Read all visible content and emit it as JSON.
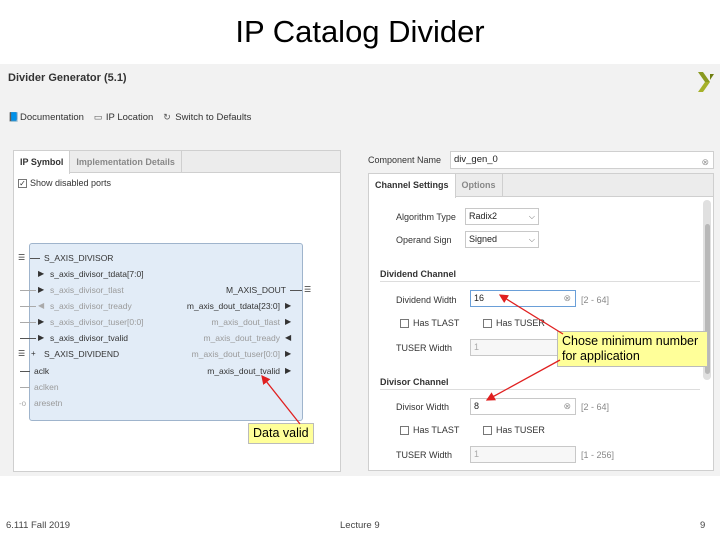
{
  "slide": {
    "title": "IP Catalog Divider",
    "footer_left": "6.111 Fall 2019",
    "footer_center": "Lecture 9",
    "footer_right": "9"
  },
  "app": {
    "header": "Divider Generator (5.1)",
    "toolbar": {
      "documentation": "Documentation",
      "ip_location": "IP Location",
      "switch_defaults": "Switch to Defaults"
    },
    "left_tabs": [
      "IP Symbol",
      "Implementation Details"
    ],
    "show_disabled_ports": "Show disabled ports",
    "symbol": {
      "left_ports": [
        {
          "name": "S_AXIS_DIVISOR",
          "dim": false
        },
        {
          "name": "s_axis_divisor_tdata[7:0]",
          "dim": false
        },
        {
          "name": "s_axis_divisor_tlast",
          "dim": true
        },
        {
          "name": "s_axis_divisor_tready",
          "dim": true
        },
        {
          "name": "s_axis_divisor_tuser[0:0]",
          "dim": true
        },
        {
          "name": "s_axis_divisor_tvalid",
          "dim": false
        },
        {
          "name": "S_AXIS_DIVIDEND",
          "dim": false
        },
        {
          "name": "aclk",
          "dim": false
        },
        {
          "name": "aclken",
          "dim": true
        },
        {
          "name": "aresetn",
          "dim": true
        }
      ],
      "right_ports": [
        {
          "name": "M_AXIS_DOUT",
          "dim": false
        },
        {
          "name": "m_axis_dout_tdata[23:0]",
          "dim": false
        },
        {
          "name": "m_axis_dout_tlast",
          "dim": true
        },
        {
          "name": "m_axis_dout_tready",
          "dim": true
        },
        {
          "name": "m_axis_dout_tuser[0:0]",
          "dim": true
        },
        {
          "name": "m_axis_dout_tvalid",
          "dim": false
        }
      ]
    },
    "component_name_label": "Component Name",
    "component_name_value": "div_gen_0",
    "right_tabs": [
      "Channel Settings",
      "Options"
    ],
    "algorithm_type_label": "Algorithm Type",
    "algorithm_type_value": "Radix2",
    "operand_sign_label": "Operand Sign",
    "operand_sign_value": "Signed",
    "dividend_channel": {
      "heading": "Dividend Channel",
      "width_label": "Dividend Width",
      "width_value": "16",
      "range": "[2 - 64]",
      "has_tlast": "Has TLAST",
      "has_tuser": "Has TUSER",
      "tuser_width_label": "TUSER Width",
      "tuser_width_value": "1"
    },
    "divisor_channel": {
      "heading": "Divisor Channel",
      "width_label": "Divisor Width",
      "width_value": "8",
      "range": "[2 - 64]",
      "has_tlast": "Has TLAST",
      "has_tuser": "Has TUSER",
      "tuser_width_label": "TUSER Width",
      "tuser_width_value": "1",
      "tuser_range": "[1 - 256]"
    }
  },
  "annotations": {
    "callout_min": "Chose minimum number for application",
    "callout_valid": "Data valid"
  },
  "colors": {
    "callout_bg": "#ffff99",
    "arrow": "#e02020",
    "symbol_fill": "#e2ecf7"
  }
}
